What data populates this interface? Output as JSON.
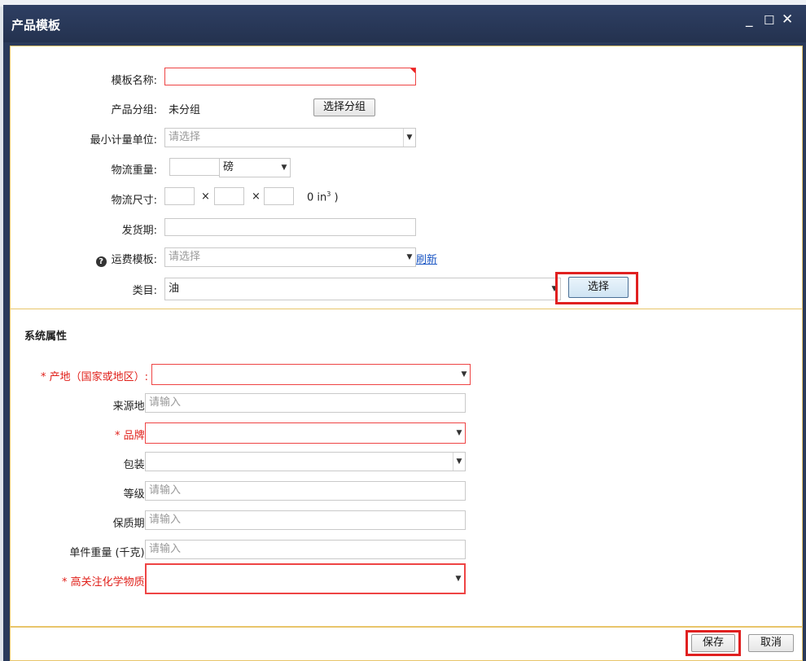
{
  "window": {
    "title": "产品模板",
    "minimize_icon": "minimize-icon",
    "maximize_icon": "maximize-icon",
    "close_icon": "close-icon"
  },
  "basic": {
    "template_name": {
      "label": "模板名称:",
      "value": ""
    },
    "product_group": {
      "label": "产品分组:",
      "value": "未分组",
      "button": "选择分组"
    },
    "min_unit": {
      "label": "最小计量单位:",
      "placeholder": "请选择"
    },
    "logistics_weight": {
      "label": "物流重量:",
      "value": "",
      "unit": "磅"
    },
    "logistics_size": {
      "label": "物流尺寸:",
      "sep1": "×",
      "sep2": "×",
      "result": "0 in",
      "sup": "3",
      "close": ")"
    },
    "ship_period": {
      "label": "发货期:",
      "value": ""
    },
    "shipping_template": {
      "label": "运费模板:",
      "placeholder": "请选择",
      "refresh": "刷新"
    },
    "category": {
      "label": "类目:",
      "value": "油",
      "button": "选择"
    }
  },
  "system_attrs": {
    "title": "系统属性",
    "origin": {
      "label": "* 产地（国家或地区）:",
      "value": ""
    },
    "source": {
      "label": "来源地:",
      "placeholder": "请输入"
    },
    "brand": {
      "label": "* 品牌:",
      "value": ""
    },
    "packaging": {
      "label": "包装:",
      "value": ""
    },
    "grade": {
      "label": "等级:",
      "placeholder": "请输入"
    },
    "shelf_life": {
      "label": "保质期:",
      "placeholder": "请输入"
    },
    "unit_weight": {
      "label": "单件重量 (千克):",
      "placeholder": "请输入"
    },
    "chemicals": {
      "label": "* 高关注化学物质:",
      "value": ""
    }
  },
  "footer": {
    "save": "保存",
    "cancel": "取消"
  },
  "colors": {
    "titlebar": "#24324f",
    "required": "#e0201a",
    "highlight": "#e02020",
    "section_border": "#e8c56a"
  }
}
